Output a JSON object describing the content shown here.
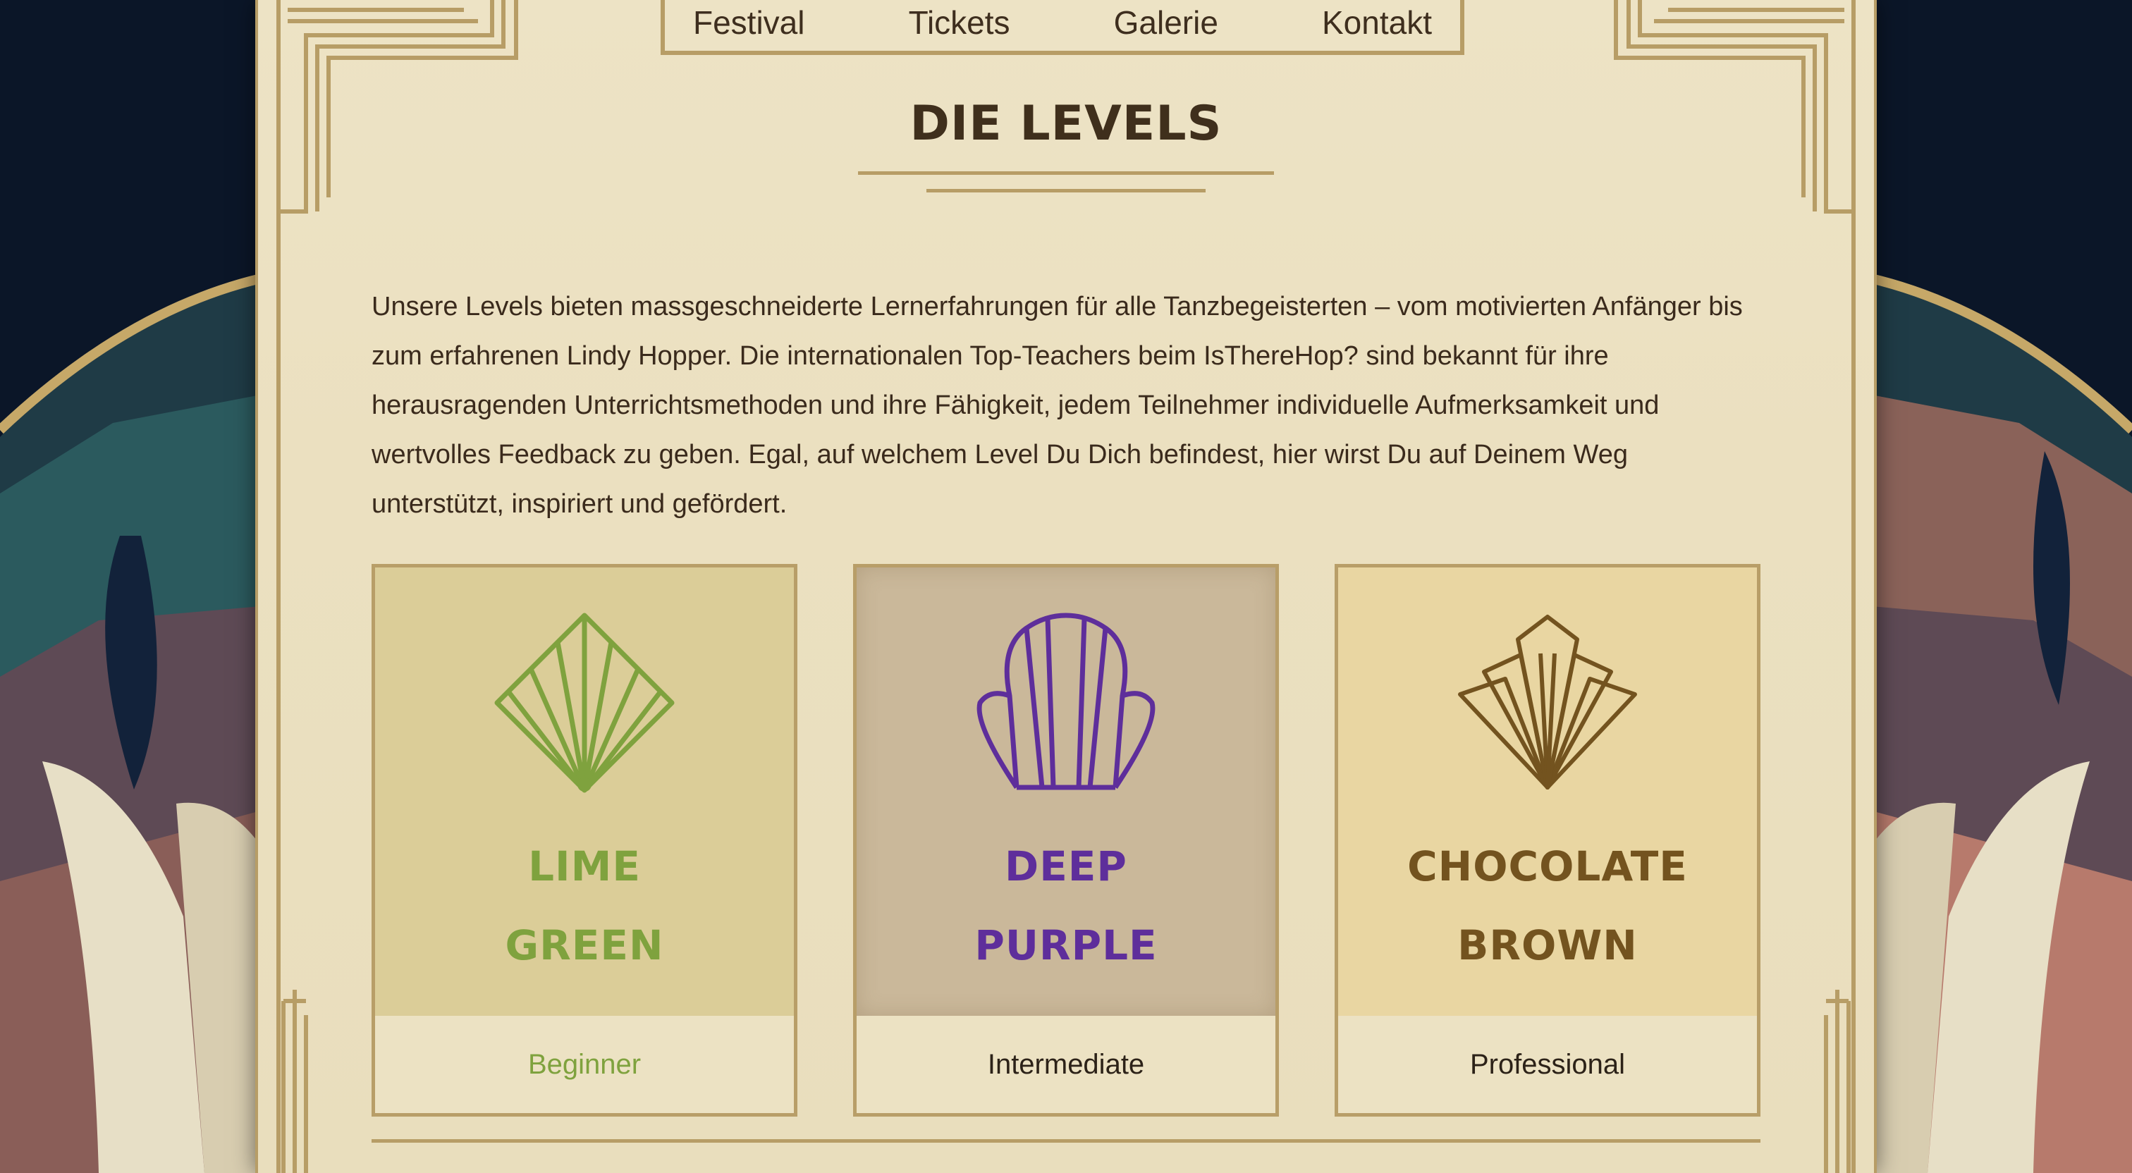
{
  "nav": {
    "items": [
      "Festival",
      "Tickets",
      "Galerie",
      "Kontakt"
    ]
  },
  "section": {
    "title": "DIE LEVELS",
    "intro": "Unsere Levels bieten massgeschneiderte Lernerfahrungen für alle Tanzbegeisterten – vom motivierten Anfänger bis zum erfahrenen Lindy Hopper. Die internationalen Top-Teachers beim IsThereHop? sind bekannt für ihre herausragenden Unterrichtsmethoden und ihre Fähigkeit, jedem Teilnehmer individuelle Aufmerksamkeit und wertvolles Feedback zu geben. Egal, auf welchem Level Du Dich befindest, hier wirst Du auf Deinem Weg unterstützt, inspiriert und gefördert."
  },
  "levels": [
    {
      "name_line1": "LIME",
      "name_line2": "GREEN",
      "level": "Beginner",
      "color": "#7fa23e",
      "icon": "fan-diamond-icon"
    },
    {
      "name_line1": "DEEP",
      "name_line2": "PURPLE",
      "level": "Intermediate",
      "color": "#5e2e9b",
      "icon": "shell-icon"
    },
    {
      "name_line1": "CHOCOLATE",
      "name_line2": "BROWN",
      "level": "Professional",
      "color": "#73531f",
      "icon": "fan-layered-icon"
    }
  ],
  "colors": {
    "paper": "#ede3c5",
    "gold": "#b79d66",
    "text": "#3e2e1e"
  }
}
